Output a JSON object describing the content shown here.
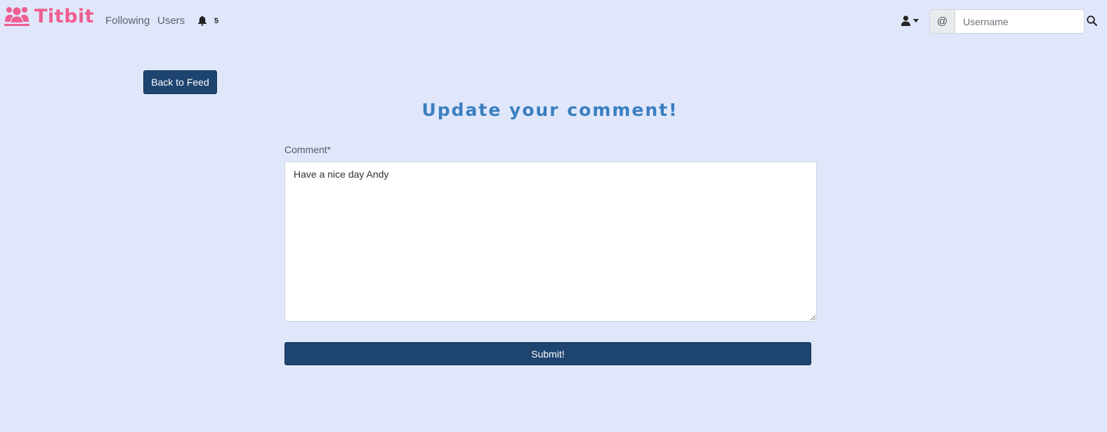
{
  "navbar": {
    "brand": "Titbit",
    "brand_icon": "users-icon",
    "links": {
      "following": "Following",
      "users": "Users"
    },
    "notifications": {
      "icon": "bell-icon",
      "count": "5"
    },
    "user_menu_icon": "user-icon",
    "search": {
      "prefix": "@",
      "placeholder": "Username",
      "value": "",
      "icon": "search-icon"
    }
  },
  "main": {
    "back_button": "Back to Feed",
    "title": "Update your comment!",
    "form": {
      "comment_label": "Comment*",
      "comment_value": "Have a nice day Andy",
      "submit_label": "Submit!"
    }
  },
  "colors": {
    "background": "#e1e7fb",
    "brand": "#ef5e8f",
    "title": "#3a7fc0",
    "button": "#1e4470"
  }
}
